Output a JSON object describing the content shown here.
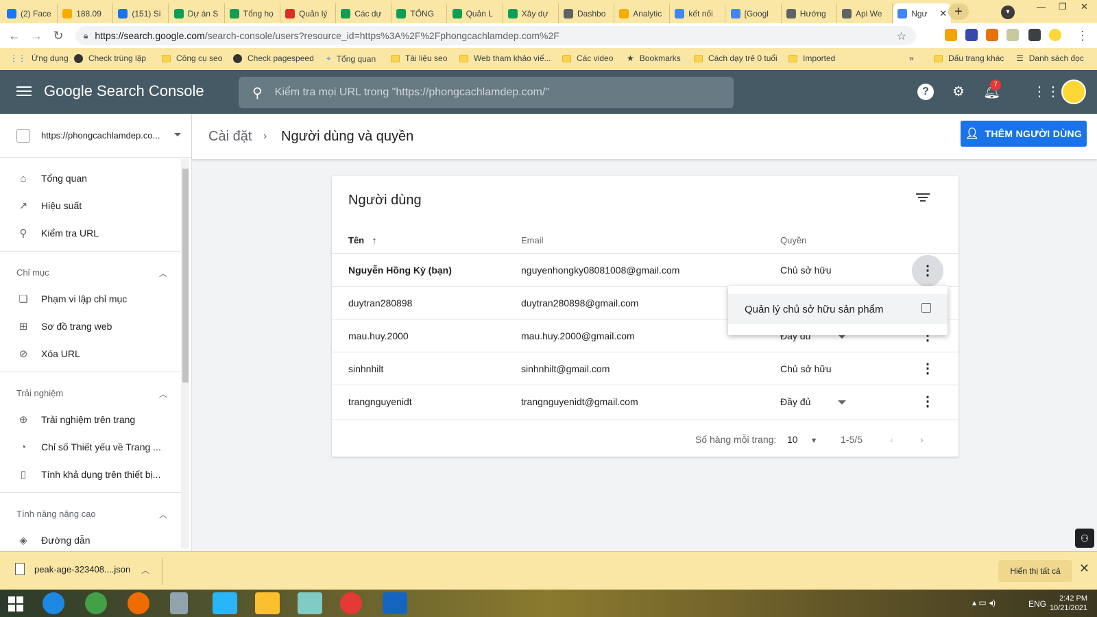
{
  "browser": {
    "tabs": [
      {
        "label": "(2) Face",
        "color": "#1877f2"
      },
      {
        "label": "188.09",
        "color": "#f9ab00"
      },
      {
        "label": "(151) Si",
        "color": "#1a73e8"
      },
      {
        "label": "Dự án S",
        "color": "#0f9d58"
      },
      {
        "label": "Tổng họ",
        "color": "#0f9d58"
      },
      {
        "label": "Quản lý",
        "color": "#d93025"
      },
      {
        "label": "Các dự",
        "color": "#0f9d58"
      },
      {
        "label": "TỔNG",
        "color": "#0f9d58"
      },
      {
        "label": "Quản L",
        "color": "#0f9d58"
      },
      {
        "label": "Xây dự",
        "color": "#0f9d58"
      },
      {
        "label": "Dashbo",
        "color": "#5f6368"
      },
      {
        "label": "Analytic",
        "color": "#f9ab00"
      },
      {
        "label": "kết nối",
        "color": "#4285f4"
      },
      {
        "label": "[Googl",
        "color": "#4285f4"
      },
      {
        "label": "Hướng",
        "color": "#5f6368"
      },
      {
        "label": "Api We",
        "color": "#5f6368"
      },
      {
        "label": "Ngư",
        "color": "#4285f4"
      }
    ],
    "active_tab_close": "✕",
    "new_tab": "+",
    "url_host": "https://search.google.com",
    "url_path": "/search-console/users?resource_id=https%3A%2F%2Fphongcachlamdep.com%2F"
  },
  "bookmarks": [
    {
      "label": "Ứng dụng",
      "icon": "apps-icon"
    },
    {
      "label": "Check trùng lặp",
      "icon": "globe-icon"
    },
    {
      "label": "Công cụ seo",
      "icon": "folder-icon"
    },
    {
      "label": "Check pagespeed",
      "icon": "globe-icon"
    },
    {
      "label": "Tổng quan",
      "icon": "gsc-icon"
    },
    {
      "label": "Tài liệu seo",
      "icon": "folder-icon"
    },
    {
      "label": "Web tham khảo viế...",
      "icon": "folder-icon"
    },
    {
      "label": "Các video",
      "icon": "folder-icon"
    },
    {
      "label": "Bookmarks",
      "icon": "star-icon"
    },
    {
      "label": "Cách dạy trẻ 0 tuổi",
      "icon": "folder-icon"
    },
    {
      "label": "Imported",
      "icon": "folder-icon"
    }
  ],
  "bookmarks_more": "»",
  "bookmarks_right": [
    {
      "label": "Dấu trang khác",
      "icon": "folder-icon"
    },
    {
      "label": "Danh sách đọc",
      "icon": "reading-list-icon"
    }
  ],
  "gsc": {
    "logo": "Google Search Console",
    "search_placeholder": "Kiểm tra mọi URL trong \"https://phongcachlamdep.com/\"",
    "notif_count": "7"
  },
  "sidebar": {
    "property": "https://phongcachlamdep.co...",
    "items_top": [
      {
        "label": "Tổng quan",
        "icon": "home-icon"
      },
      {
        "label": "Hiệu suất",
        "icon": "trending-icon"
      },
      {
        "label": "Kiểm tra URL",
        "icon": "search-icon"
      }
    ],
    "section_index": "Chỉ mục",
    "items_index": [
      {
        "label": "Phạm vi lập chỉ mục",
        "icon": "coverage-icon"
      },
      {
        "label": "Sơ đồ trang web",
        "icon": "sitemap-icon"
      },
      {
        "label": "Xóa URL",
        "icon": "remove-icon"
      }
    ],
    "section_exp": "Trải nghiệm",
    "items_exp": [
      {
        "label": "Trải nghiệm trên trang",
        "icon": "page-exp-icon"
      },
      {
        "label": "Chỉ số Thiết yếu về Trang ...",
        "icon": "gauge-icon"
      },
      {
        "label": "Tính khả dụng trên thiết bị...",
        "icon": "mobile-icon"
      }
    ],
    "section_adv": "Tính năng nâng cao",
    "items_adv": [
      {
        "label": "Đường dẫn",
        "icon": "layers-icon"
      }
    ]
  },
  "page": {
    "breadcrumb_parent": "Cài đặt",
    "breadcrumb_sep": "›",
    "title": "Người dùng và quyền",
    "add_user_label": "THÊM NGƯỜI DÙNG"
  },
  "users_card": {
    "title": "Người dùng",
    "col_name": "Tên",
    "col_email": "Email",
    "col_perm": "Quyền",
    "rows": [
      {
        "name": "Nguyễn Hồng Kỳ (bạn)",
        "email": "nguyenhongky08081008@gmail.com",
        "perm": "Chủ sở hữu",
        "bold": true
      },
      {
        "name": "duytran280898",
        "email": "duytran280898@gmail.com",
        "perm": "",
        "bold": false
      },
      {
        "name": "mau.huy.2000",
        "email": "mau.huy.2000@gmail.com",
        "perm": "Đầy đủ",
        "bold": false
      },
      {
        "name": "sinhnhilt",
        "email": "sinhnhilt@gmail.com",
        "perm": "Chủ sở hữu",
        "bold": false
      },
      {
        "name": "trangnguyenidt",
        "email": "trangnguyenidt@gmail.com",
        "perm": "Đầy đủ",
        "bold": false
      }
    ],
    "rows_per_page_label": "Số hàng mỗi trang:",
    "rows_per_page": "10",
    "range": "1-5/5"
  },
  "context_menu": {
    "item": "Quản lý chủ sở hữu sản phẩm"
  },
  "download_bar": {
    "file": "peak-age-323408....json",
    "show_all": "Hiển thị tất cả"
  },
  "taskbar": {
    "lang": "ENG",
    "time": "2:42 PM",
    "date": "10/21/2021"
  }
}
